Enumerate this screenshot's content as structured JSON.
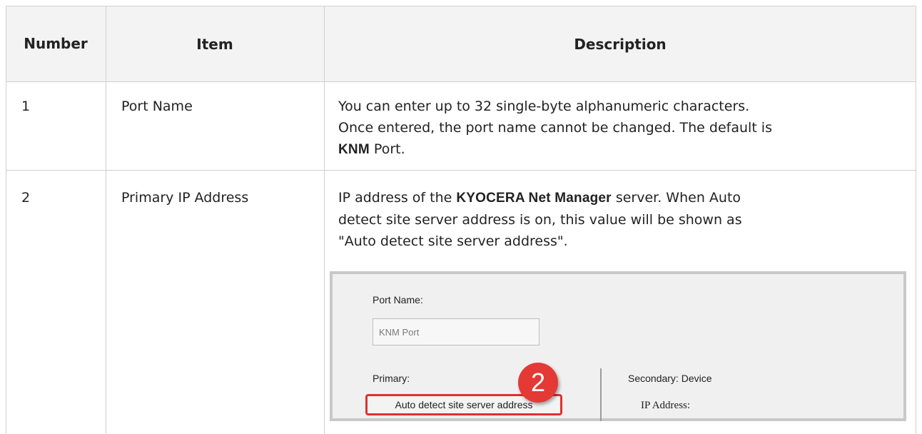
{
  "headers": {
    "number": "Number",
    "item": "Item",
    "description": "Description"
  },
  "rows": [
    {
      "number": "1",
      "item": "Port Name",
      "desc_line1": "You can enter up to 32 single-byte alphanumeric characters.",
      "desc_line2": "Once entered, the port name cannot be changed. The default is",
      "desc_bold": "KNM",
      "desc_tail": " Port."
    },
    {
      "number": "2",
      "item": "Primary IP Address",
      "desc_pre": "IP address of the ",
      "desc_bold": "KYOCERA Net Manager",
      "desc_post": " server. When Auto",
      "desc_line2": "detect site server address is on, this value will be shown as",
      "desc_line3": "\"Auto detect site server address\"."
    }
  ],
  "dialog": {
    "port_name_label": "Port Name:",
    "port_name_value": "KNM Port",
    "primary_label": "Primary:",
    "primary_value": "Auto detect site server address",
    "badge": "2",
    "secondary_label": "Secondary: Device",
    "ip_address_label": "IP Address:"
  }
}
